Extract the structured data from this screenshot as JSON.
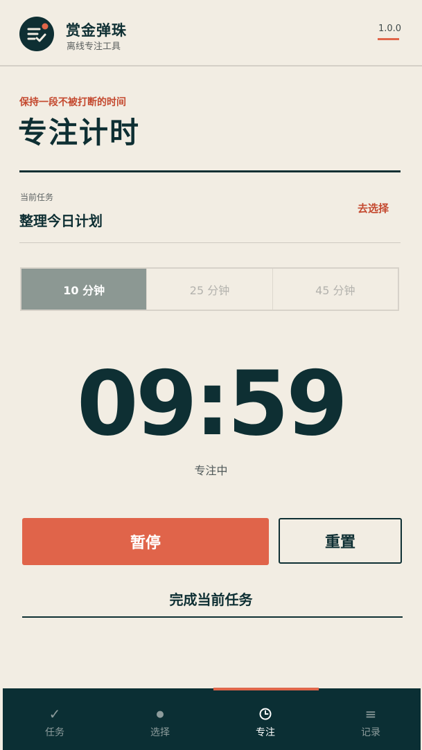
{
  "app": {
    "title": "赏金弹珠",
    "subtitle": "离线专注工具",
    "version": "1.0.0"
  },
  "page": {
    "kicker": "保持一段不被打断的时间",
    "title": "专注计时"
  },
  "task": {
    "label": "当前任务",
    "name": "整理今日计划",
    "choose_label": "去选择"
  },
  "durations": [
    {
      "label": "10 分钟",
      "active": true
    },
    {
      "label": "25 分钟",
      "active": false
    },
    {
      "label": "45 分钟",
      "active": false
    }
  ],
  "timer": {
    "display": "09:59",
    "status": "专注中"
  },
  "buttons": {
    "pause": "暂停",
    "reset": "重置",
    "complete": "完成当前任务"
  },
  "tabs": [
    {
      "label": "任务",
      "icon": "check-icon",
      "glyph": "✓"
    },
    {
      "label": "选择",
      "icon": "dot-icon",
      "glyph": "●"
    },
    {
      "label": "专注",
      "icon": "clock-icon",
      "glyph": ""
    },
    {
      "label": "记录",
      "icon": "list-icon",
      "glyph": "≡"
    }
  ],
  "active_tab": "专注",
  "colors": {
    "primary": "#0e2f33",
    "accent": "#e0644a",
    "background": "#f2ede3",
    "muted_active": "#8c9893"
  }
}
